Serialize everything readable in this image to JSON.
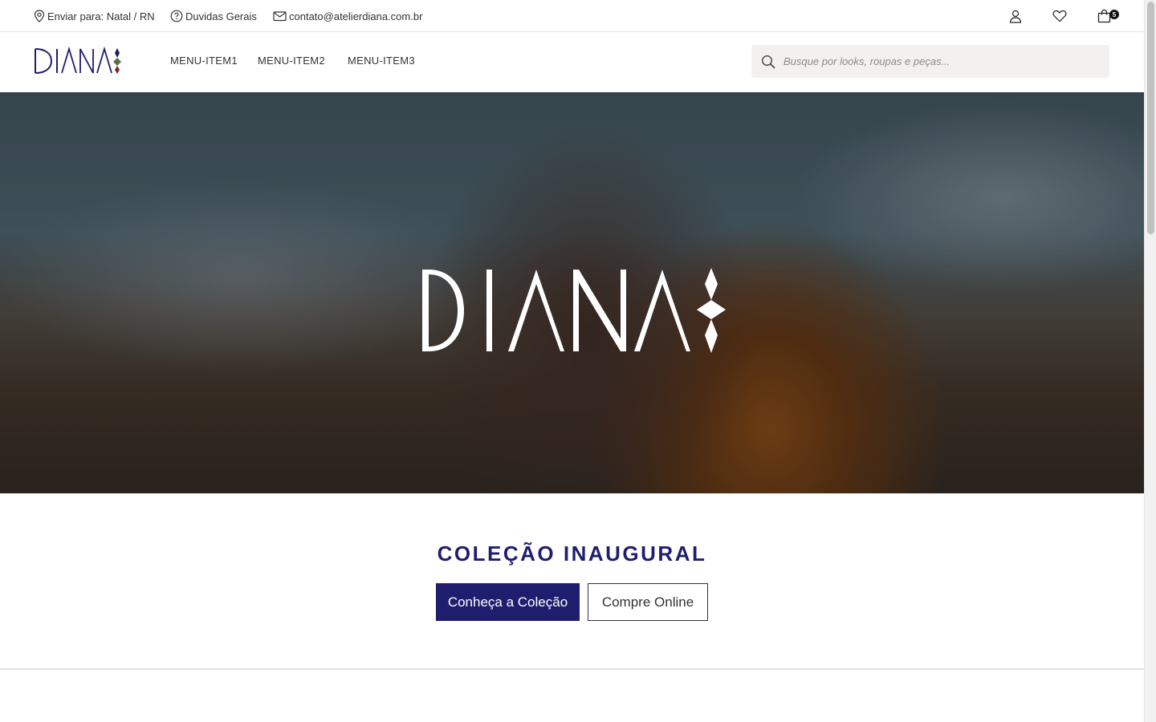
{
  "topbar": {
    "shipping": "Enviar para: Natal / RN",
    "help": "Duvidas Gerais",
    "email": "contato@atelierdiana.com.br",
    "cart_count": "5"
  },
  "brand": {
    "logo_text": "DIANA",
    "color": "#1f1e6e"
  },
  "nav": {
    "items": [
      {
        "label": "MENU-ITEM1"
      },
      {
        "label": "MENU-ITEM2"
      },
      {
        "label": "MENU-ITEM3"
      }
    ],
    "search_placeholder": "Busque por looks, roupas e peças..."
  },
  "hero": {
    "logo_text": "DIANA"
  },
  "collection": {
    "title": "COLEÇÃO INAUGURAL",
    "primary_button": "Conheça a Coleção",
    "secondary_button": "Compre Online"
  },
  "icons": [
    "map-pin-icon",
    "help-circle-icon",
    "mail-icon",
    "user-icon",
    "heart-icon",
    "shopping-bag-icon",
    "search-icon"
  ]
}
